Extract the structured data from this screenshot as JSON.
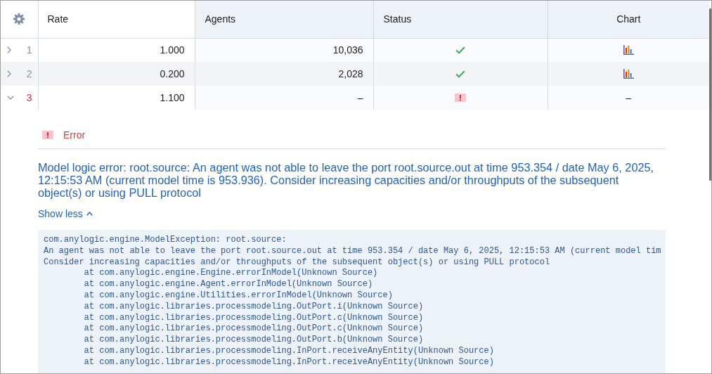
{
  "table": {
    "columns": [
      {
        "label": "Rate",
        "kind": "input"
      },
      {
        "label": "Agents",
        "kind": "output"
      },
      {
        "label": "Status",
        "kind": "status"
      },
      {
        "label": "Chart",
        "kind": "chart"
      }
    ],
    "rows": [
      {
        "number": "1",
        "expanded": false,
        "cells": [
          {
            "kind": "text",
            "text": "1.000"
          },
          {
            "kind": "text",
            "text": "10,036"
          },
          {
            "kind": "status",
            "error": false
          },
          {
            "kind": "chart"
          }
        ]
      },
      {
        "number": "2",
        "expanded": false,
        "cells": [
          {
            "kind": "text",
            "text": "0.200"
          },
          {
            "kind": "text",
            "text": "2,028"
          },
          {
            "kind": "status",
            "error": false
          },
          {
            "kind": "chart"
          }
        ]
      },
      {
        "number": "3",
        "expanded": true,
        "cells": [
          {
            "kind": "text",
            "text": "1.100"
          },
          {
            "kind": "text",
            "text": "–"
          },
          {
            "kind": "status",
            "error": true
          },
          {
            "kind": "text",
            "text": "–"
          }
        ],
        "detail": {
          "title": "Error",
          "message": "Model logic error: root.source: An agent was not able to leave the port root.source.out at time 953.354 / date May 6, 2025, 12:15:53 AM (current model time is 953.936). Consider increasing capacities and/or throughputs of the subsequent object(s) or using PULL protocol",
          "toggle": "Show less",
          "trace": [
            "com.anylogic.engine.ModelException: root.source:",
            "An agent was not able to leave the port root.source.out at time 953.354 / date May 6, 2025, 12:15:53 AM (current model tim",
            "Consider increasing capacities and/or throughputs of the subsequent object(s) or using PULL protocol",
            "\tat com.anylogic.engine.Engine.errorInModel(Unknown Source)",
            "\tat com.anylogic.engine.Agent.errorInModel(Unknown Source)",
            "\tat com.anylogic.engine.Utilities.errorInModel(Unknown Source)",
            "\tat com.anylogic.libraries.processmodeling.OutPort.i(Unknown Source)",
            "\tat com.anylogic.libraries.processmodeling.OutPort.c(Unknown Source)",
            "\tat com.anylogic.libraries.processmodeling.OutPort.c(Unknown Source)",
            "\tat com.anylogic.libraries.processmodeling.OutPort.b(Unknown Source)",
            "\tat com.anylogic.libraries.processmodeling.InPort.receiveAnyEntity(Unknown Source)",
            "\tat com.anylogic.libraries.processmodeling.InPort.receiveAnyEntity(Unknown Source)"
          ]
        }
      }
    ]
  }
}
